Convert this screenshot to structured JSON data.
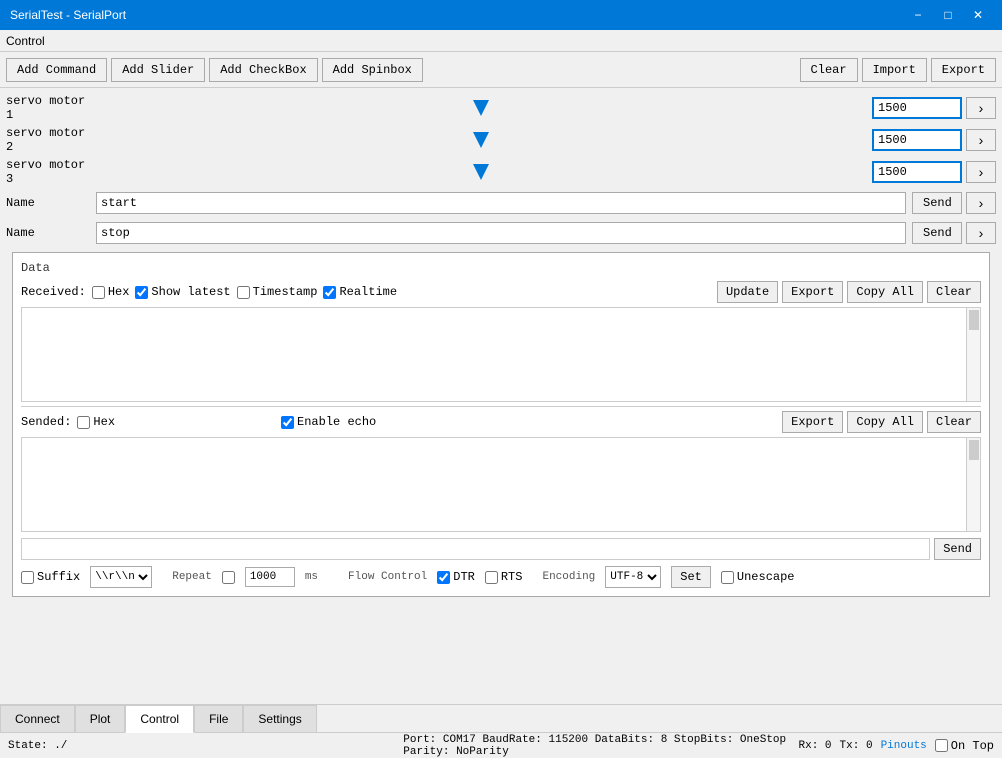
{
  "window": {
    "title": "SerialTest - SerialPort"
  },
  "menu": {
    "label": "Control"
  },
  "toolbar": {
    "add_command": "Add Command",
    "add_slider": "Add Slider",
    "add_checkbox": "Add CheckBox",
    "add_spinbox": "Add Spinbox",
    "clear": "Clear",
    "import": "Import",
    "export": "Export"
  },
  "sliders": [
    {
      "label": "servo motor 1",
      "value": "1500",
      "min": 0,
      "max": 3000,
      "position": 50
    },
    {
      "label": "servo motor 2",
      "value": "1500",
      "min": 0,
      "max": 3000,
      "position": 50
    },
    {
      "label": "servo motor 3",
      "value": "1500",
      "min": 0,
      "max": 3000,
      "position": 50
    }
  ],
  "name_rows": [
    {
      "label": "Name",
      "value": "start"
    },
    {
      "label": "Name",
      "value": "stop"
    }
  ],
  "buttons": {
    "send": "Send",
    "arrow": "›"
  },
  "data_panel": {
    "title": "Data",
    "received_label": "Received:",
    "hex_label": "Hex",
    "show_latest_label": "Show latest",
    "timestamp_label": "Timestamp",
    "realtime_label": "Realtime",
    "hex_checked": false,
    "show_latest_checked": true,
    "timestamp_checked": false,
    "realtime_checked": true,
    "update_btn": "Update",
    "export_btn": "Export",
    "copy_all_btn": "Copy All",
    "clear_btn": "Clear",
    "received_content": "",
    "sended_label": "Sended:",
    "hex2_label": "Hex",
    "enable_echo_label": "Enable echo",
    "hex2_checked": false,
    "enable_echo_checked": true,
    "export2_btn": "Export",
    "copy_all2_btn": "Copy All",
    "clear2_btn": "Clear",
    "sended_content": "",
    "send_input_value": "",
    "send_btn": "Send",
    "suffix_label": "Suffix",
    "suffix_checked": false,
    "suffix_value": "\\r\\n",
    "repeat_label": "Repeat",
    "repeat_checked": false,
    "repeat_value": "1000",
    "repeat_unit": "ms",
    "flow_control_label": "Flow Control",
    "dtr_label": "DTR",
    "rts_label": "RTS",
    "dtr_checked": true,
    "rts_checked": false,
    "encoding_label": "Encoding",
    "encoding_value": "UTF-8",
    "set_btn": "Set",
    "unescape_label": "Unescape",
    "unescape_checked": false
  },
  "tabs": [
    {
      "label": "Connect",
      "active": false
    },
    {
      "label": "Plot",
      "active": false
    },
    {
      "label": "Control",
      "active": true
    },
    {
      "label": "File",
      "active": false
    },
    {
      "label": "Settings",
      "active": false
    }
  ],
  "status": {
    "state": "State: ./",
    "port_info": "Port: COM17 BaudRate: 115200 DataBits: 8 StopBits: OneStop Parity: NoParity",
    "rx": "Rx: 0",
    "tx": "Tx: 0",
    "pinouts": "Pinouts",
    "on_top": "On Top",
    "on_top_checked": false
  }
}
